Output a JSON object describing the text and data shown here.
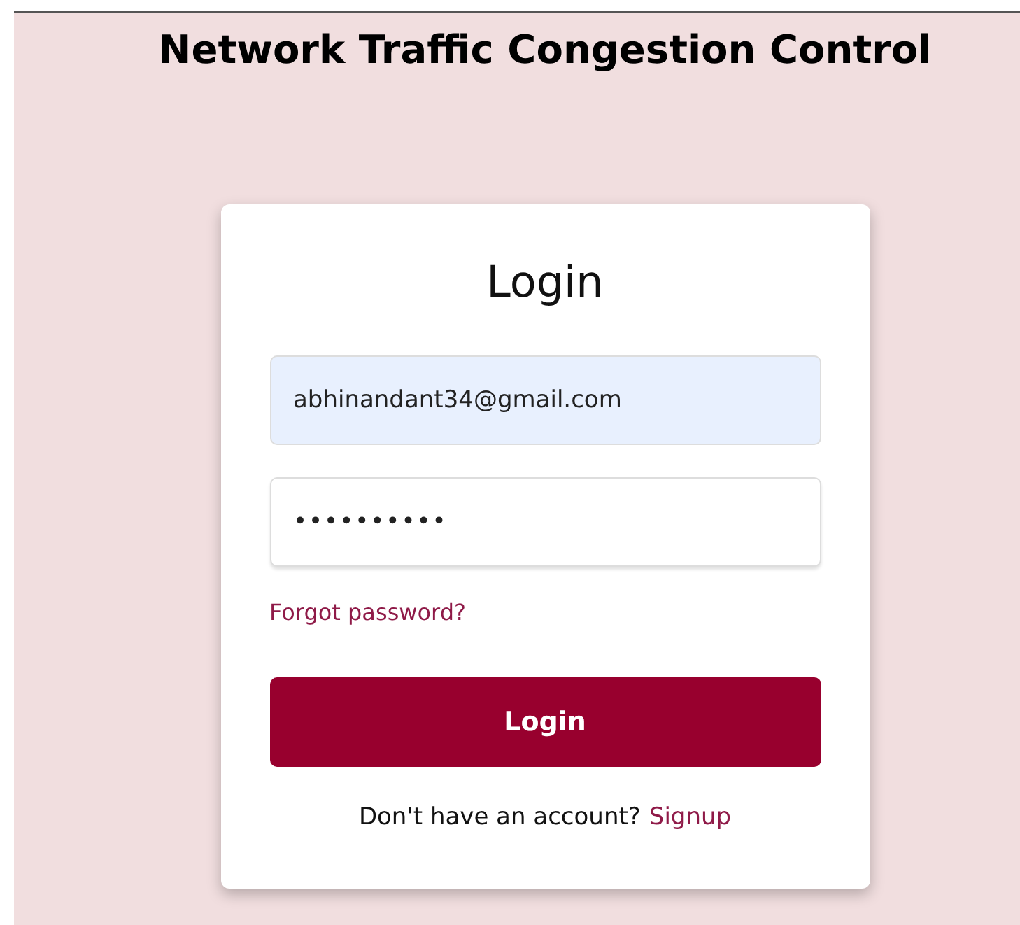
{
  "page": {
    "title": "Network Traffic Congestion Control"
  },
  "login_card": {
    "heading": "Login",
    "email_field": {
      "value": "abhinandant34@gmail.com",
      "autofilled": true
    },
    "password_field": {
      "value": "••••••••••"
    },
    "forgot_link": "Forgot password?",
    "login_button": "Login",
    "signup_prompt": "Don't have an account?",
    "signup_link": "Signup"
  }
}
